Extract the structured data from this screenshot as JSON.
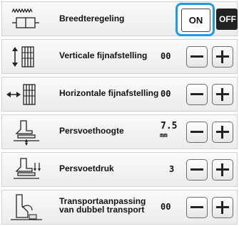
{
  "rows": [
    {
      "label": "Breedteregeling",
      "toggle_on": "ON",
      "toggle_off": "OFF",
      "state": "ON"
    },
    {
      "label": "Verticale fijnafstelling",
      "value": "00"
    },
    {
      "label": "Horizontale fijnafstelling",
      "value": "00"
    },
    {
      "label": "Persvoethoogte",
      "value": "7.5",
      "unit": "mm"
    },
    {
      "label": "Persvoetdruk",
      "value": "3"
    },
    {
      "label_line1": "Transportaanpassing",
      "label_line2": "van dubbel transport",
      "value": "00"
    }
  ],
  "colors": {
    "accent": "#1e9be6",
    "off_button": "#222222"
  },
  "icons": [
    "width-control-icon",
    "vertical-fine-adjust-icon",
    "horizontal-fine-adjust-icon",
    "presser-foot-height-icon",
    "presser-foot-pressure-icon",
    "dual-feed-icon"
  ]
}
